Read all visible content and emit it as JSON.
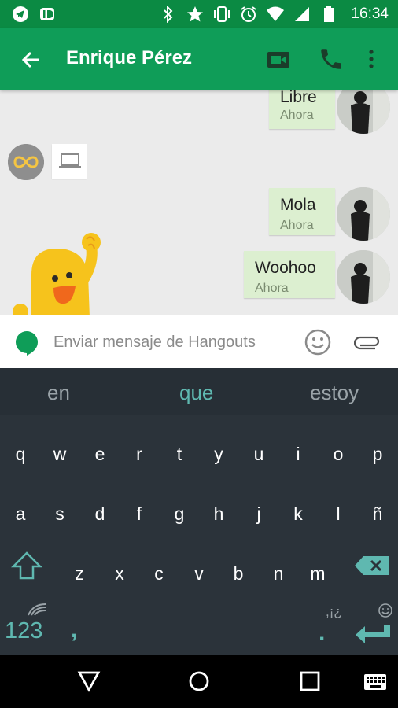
{
  "status_bar": {
    "time": "16:34",
    "left_icons": [
      "telegram-icon",
      "id-icon"
    ],
    "right_icons": [
      "bluetooth-icon",
      "star-icon",
      "vibrate-icon",
      "alarm-icon",
      "wifi-icon",
      "signal-icon",
      "battery-icon"
    ]
  },
  "app_bar": {
    "title": "Enrique Pérez",
    "icons": [
      "back-arrow-icon",
      "video-call-icon",
      "phone-icon",
      "more-vert-icon"
    ]
  },
  "chat": {
    "messages": [
      {
        "text": "Libre",
        "time": "Ahora"
      },
      {
        "text": "Mola",
        "time": "Ahora"
      },
      {
        "text": "Woohoo",
        "time": "Ahora"
      }
    ]
  },
  "composer": {
    "placeholder": "Enviar mensaje de Hangouts"
  },
  "keyboard": {
    "suggestions": [
      "en",
      "que",
      "estoy"
    ],
    "row1": [
      "q",
      "w",
      "e",
      "r",
      "t",
      "y",
      "u",
      "i",
      "o",
      "p"
    ],
    "row2": [
      "a",
      "s",
      "d",
      "f",
      "g",
      "h",
      "j",
      "k",
      "l",
      "ñ"
    ],
    "row3": [
      "z",
      "x",
      "c",
      "v",
      "b",
      "n",
      "m"
    ],
    "numbers_label": "123",
    "comma_label": ",",
    "period_label": ".",
    "punct_hint": ",¡¿"
  },
  "colors": {
    "status_bar": "#0b8a43",
    "app_bar": "#0f9d58",
    "bubble": "#dcefd0",
    "keyboard_bg": "#2b333a",
    "accent": "#5fb8b0"
  }
}
